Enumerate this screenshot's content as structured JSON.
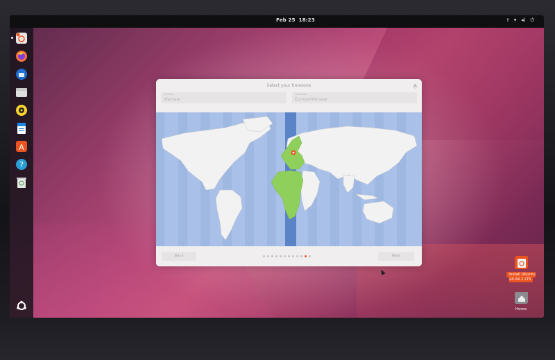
{
  "topbar": {
    "date": "Feb 25",
    "time": "18:23",
    "tray_icons": [
      "accessibility-icon",
      "network-icon",
      "volume-icon",
      "power-icon"
    ]
  },
  "dock": {
    "items": [
      {
        "name": "installer-icon",
        "color": "#e9e6e6"
      },
      {
        "name": "firefox-icon",
        "color": "#ff7139"
      },
      {
        "name": "thunderbird-icon",
        "color": "#1f6fd1"
      },
      {
        "name": "files-icon",
        "color": "#dedede"
      },
      {
        "name": "rhythmbox-icon",
        "color": "#f6d32d"
      },
      {
        "name": "writer-icon",
        "color": "#1e88e5"
      },
      {
        "name": "app-center-icon",
        "color": "#e95420"
      },
      {
        "name": "help-icon",
        "color": "#2a9fd6"
      },
      {
        "name": "trash-icon",
        "color": "#e7e7e7"
      }
    ],
    "show_apps_icon": "ubuntu-logo-icon"
  },
  "dialog": {
    "title": "Select your timezone",
    "location": {
      "label": "Location",
      "value": "Warsaw"
    },
    "timezone": {
      "label": "Timezone",
      "value": "Europe/Warsaw"
    },
    "back_label": "Back",
    "next_label": "Next",
    "progress": {
      "total": 12,
      "current": 11
    },
    "accent_color": "#e95420",
    "highlight_color": "#8fcf5b"
  },
  "desktop": {
    "install": {
      "line1": "Install Ubuntu",
      "line2": "24.04.1 LTS"
    },
    "home": {
      "label": "Home"
    }
  }
}
